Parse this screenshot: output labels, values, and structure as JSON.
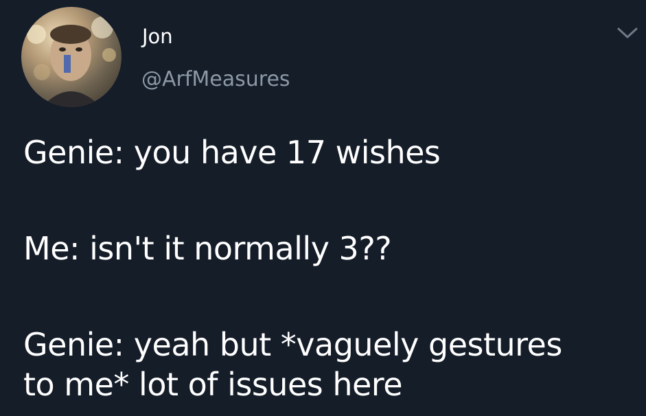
{
  "author": {
    "display_name": "Jon",
    "handle": "@ArfMeasures",
    "avatar_icon": "profile-photo"
  },
  "menu": {
    "icon": "chevron-down-icon"
  },
  "tweet": {
    "line1": "Genie: you have 17 wishes",
    "line2": "Me: isn't it normally 3??",
    "line3a": "Genie: yeah but *vaguely gestures",
    "line3b": "to me* lot of issues here"
  },
  "colors": {
    "background": "#151d29",
    "text": "#ffffff",
    "handle": "#8b98a5"
  }
}
